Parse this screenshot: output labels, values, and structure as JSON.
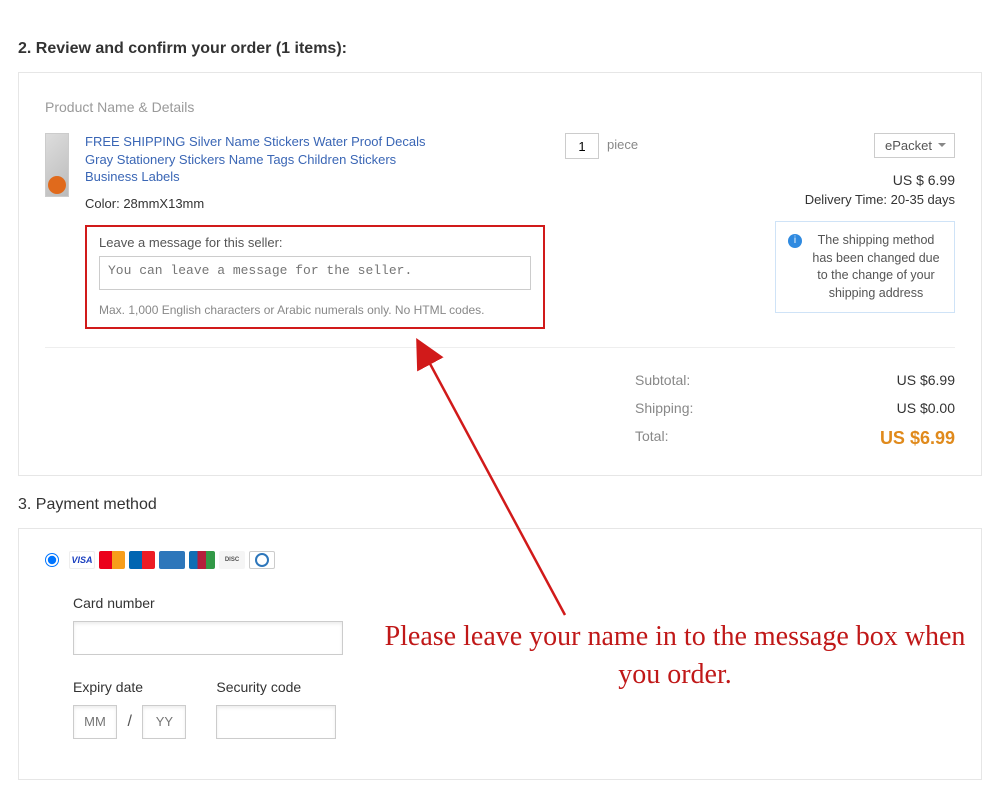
{
  "review": {
    "heading": "2. Review and confirm your order (1 items):",
    "product_label": "Product Name & Details",
    "product_name": "FREE SHIPPING Silver Name Stickers Water Proof Decals Gray Stationery Stickers Name Tags Children Stickers Business Labels",
    "variant_label": "Color:",
    "variant_value": "28mmX13mm",
    "qty": "1",
    "qty_unit": "piece",
    "shipping_method": "ePacket",
    "price": "US $ 6.99",
    "delivery_label": "Delivery Time:",
    "delivery_value": "20-35 days",
    "message_label": "Leave a message for this seller:",
    "message_placeholder": "You can leave a message for the seller.",
    "message_hint": "Max. 1,000 English characters or Arabic numerals only. No HTML codes.",
    "notice": "The shipping method has been changed due to the change of your shipping address"
  },
  "totals": {
    "subtotal_label": "Subtotal:",
    "subtotal_value": "US $6.99",
    "shipping_label": "Shipping:",
    "shipping_value": "US $0.00",
    "total_label": "Total:",
    "total_value": "US $6.99"
  },
  "payment": {
    "heading": "3. Payment method",
    "card_number_label": "Card number",
    "expiry_label": "Expiry date",
    "security_label": "Security code",
    "mm": "MM",
    "yy": "YY",
    "slash": "/"
  },
  "annotation": "Please leave your name in to the message box when you order."
}
